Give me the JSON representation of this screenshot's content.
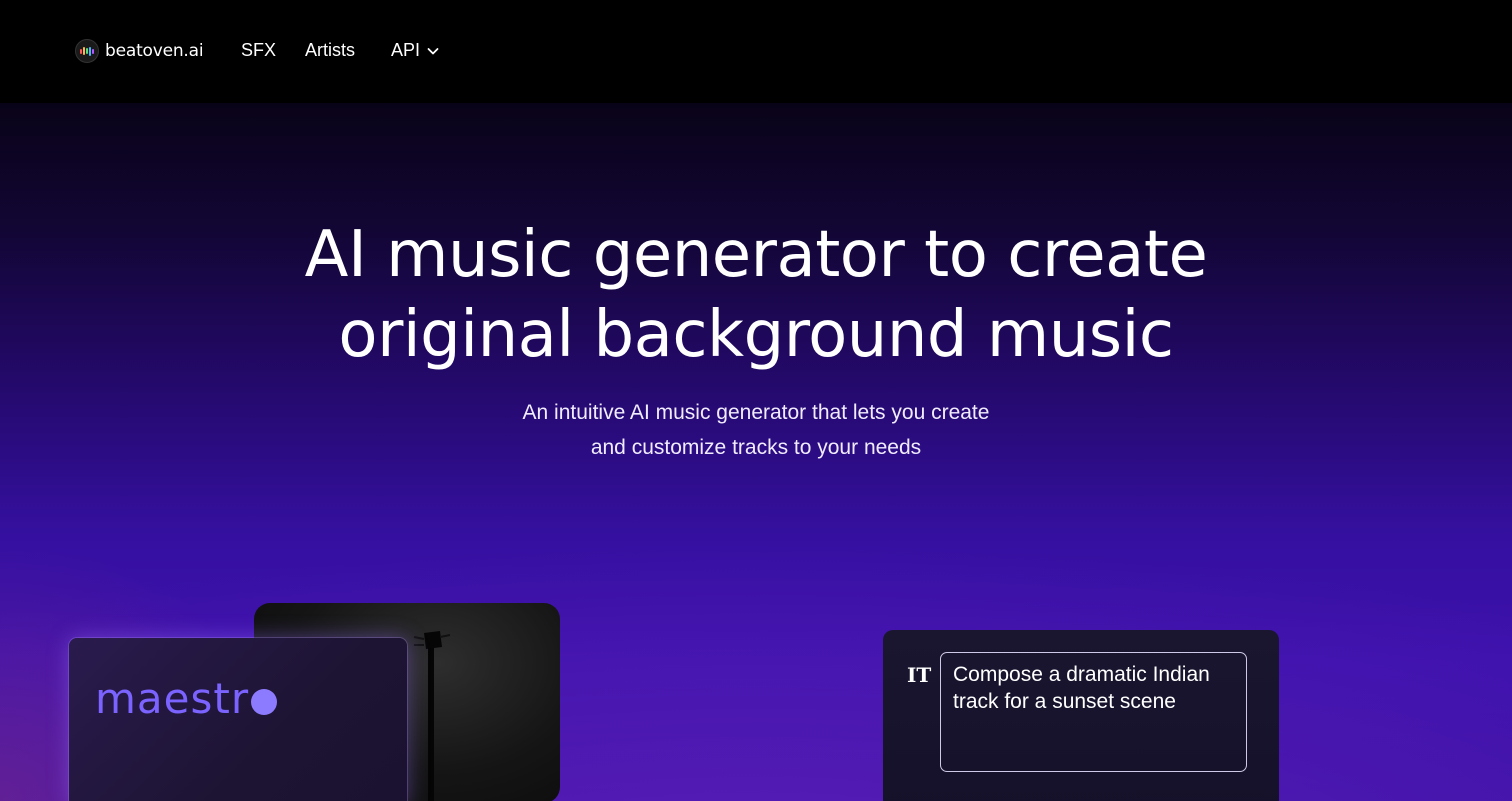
{
  "brand": {
    "name": "beatoven.ai"
  },
  "nav": {
    "items": [
      {
        "label": "SFX"
      },
      {
        "label": "Artists"
      },
      {
        "label": "API"
      }
    ]
  },
  "hero": {
    "headline_line1": "AI music generator to create",
    "headline_line2": "original background music",
    "subline_line1": "An intuitive AI music generator that lets you create",
    "subline_line2": "and customize tracks to your needs"
  },
  "cards": {
    "maestro_word": "maestr",
    "prompt_text": "Compose a dramatic Indian track for a sunset scene"
  },
  "colors": {
    "background_top": "#000000",
    "hero_purple": "#3d11ad",
    "maestro_accent": "#7b63ff"
  },
  "icons": {
    "logo": "beatoven-logo-icon",
    "api_dropdown": "chevron-down-icon",
    "prompt": "text-t-icon"
  }
}
